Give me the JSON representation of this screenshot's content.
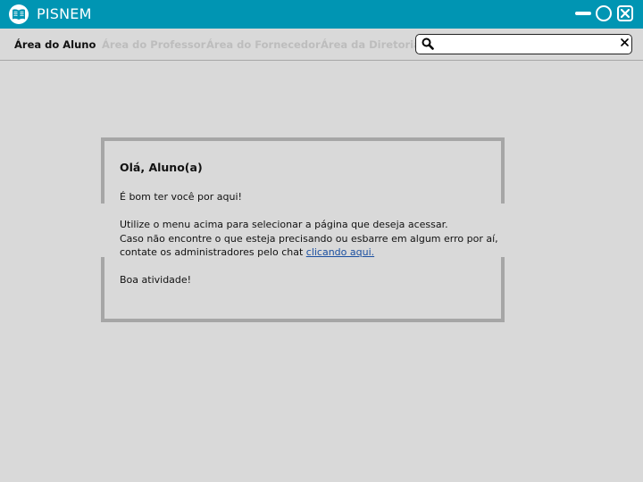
{
  "app": {
    "title": "PISNEM"
  },
  "nav": {
    "items": [
      {
        "label": "Área do Aluno",
        "active": true
      },
      {
        "label": "Área do Professor",
        "active": false
      },
      {
        "label": "Área do Fornecedor",
        "active": false
      },
      {
        "label": "Área da Diretoria",
        "active": false
      }
    ]
  },
  "search": {
    "value": "",
    "placeholder": ""
  },
  "card": {
    "greeting": "Olá, Aluno(a)",
    "welcome": "É bom ter você por aqui!",
    "line1": "Utilize o menu acima para selecionar a página que deseja acessar.",
    "line2": "Caso não encontre o que esteja precisando ou esbarre em algum erro por aí,",
    "line3_prefix": "contate os administradores pelo chat ",
    "link": "clicando aqui.",
    "closing": "Boa atividade!"
  },
  "colors": {
    "titlebar": "#0095b3",
    "background": "#d9d9d9",
    "border": "#a6a6a6",
    "link": "#1a4fa0"
  },
  "icons": [
    "book-logo-icon",
    "minimize-icon",
    "maximize-icon",
    "close-icon",
    "search-icon",
    "clear-icon"
  ]
}
